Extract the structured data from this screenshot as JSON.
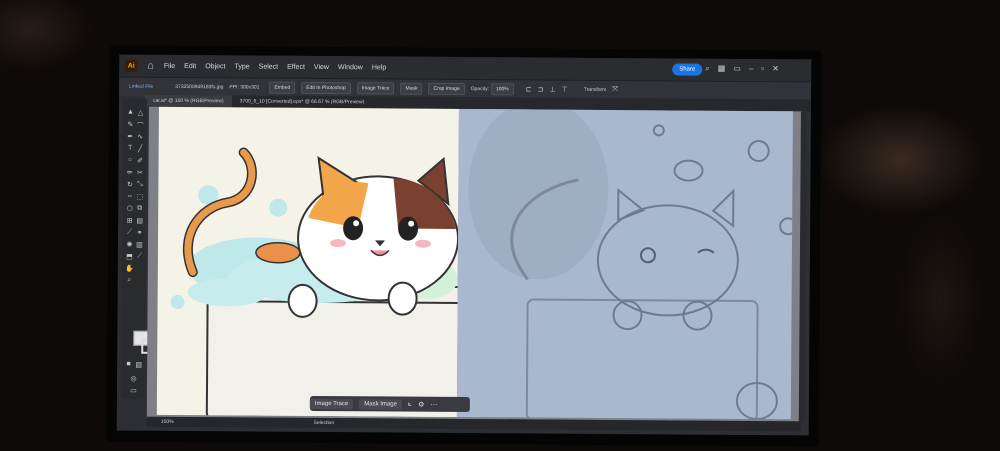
{
  "app": {
    "logo": "Ai",
    "home_icon": "home-icon"
  },
  "menu": {
    "items": [
      "File",
      "Edit",
      "Object",
      "Type",
      "Select",
      "Effect",
      "View",
      "Window",
      "Help"
    ]
  },
  "top_right": {
    "share": "Share"
  },
  "control_bar": {
    "linked_file": "Linked File",
    "filename": "3732500949183fs.jpg",
    "ppi": "PPI: 300x301",
    "embed": "Embed",
    "edit_in_photoshop": "Edit In Photoshop",
    "image_trace": "Image Trace",
    "mask": "Mask",
    "crop_image": "Crop Image",
    "opacity_label": "Opacity:",
    "opacity_value": "100%",
    "transform": "Transform"
  },
  "tabs": [
    {
      "label": "cat.ai* @ 150 % (RGB/Preview)",
      "active": true
    },
    {
      "label": "3700_6_10 [Converted].eps* @ 66.67 % (RGB/Preview)",
      "active": false
    }
  ],
  "status": {
    "zoom": "150%",
    "mode": "Selection"
  },
  "float_bar": {
    "image_trace": "Image Trace",
    "mask_image": "Mask Image"
  },
  "colors": {
    "accent": "#1b74e4",
    "artboard_left": "#f5f2e8",
    "artboard_right": "#a9b8cf"
  }
}
